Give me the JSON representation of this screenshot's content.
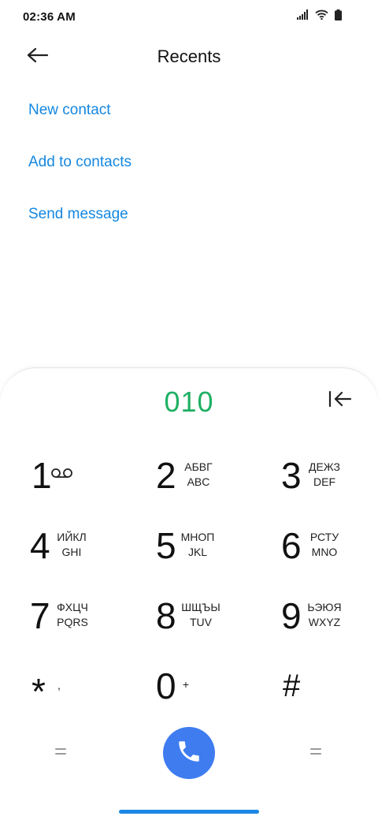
{
  "status_bar": {
    "time": "02:36 AM",
    "icons": [
      "signal-icon",
      "wifi-icon",
      "battery-icon"
    ]
  },
  "header": {
    "title": "Recents",
    "back_icon": "back-arrow-icon"
  },
  "actions": [
    {
      "label": "New contact"
    },
    {
      "label": "Add to contacts"
    },
    {
      "label": "Send message"
    }
  ],
  "dialer": {
    "number": "010",
    "backspace_icon": "backspace-icon",
    "keys": [
      {
        "digit": "1",
        "top": "",
        "bottom": "",
        "icon": "voicemail-icon"
      },
      {
        "digit": "2",
        "top": "АБВГ",
        "bottom": "ABC"
      },
      {
        "digit": "3",
        "top": "ДЕЖЗ",
        "bottom": "DEF"
      },
      {
        "digit": "4",
        "top": "ИЙКЛ",
        "bottom": "GHI"
      },
      {
        "digit": "5",
        "top": "МНОП",
        "bottom": "JKL"
      },
      {
        "digit": "6",
        "top": "РСТУ",
        "bottom": "MNO"
      },
      {
        "digit": "7",
        "top": "ФХЦЧ",
        "bottom": "PQRS"
      },
      {
        "digit": "8",
        "top": "ШЩЪЫ",
        "bottom": "TUV"
      },
      {
        "digit": "9",
        "top": "ЬЭЮЯ",
        "bottom": "WXYZ"
      },
      {
        "digit": "*",
        "top": "",
        "bottom": ","
      },
      {
        "digit": "0",
        "top": "",
        "bottom": "+"
      },
      {
        "digit": "#",
        "top": "",
        "bottom": ""
      }
    ],
    "call_icon": "phone-icon",
    "left_menu_icon": "menu-icon",
    "right_menu_icon": "menu-icon"
  },
  "colors": {
    "accent_link": "#1487e0",
    "dialed_number": "#1eb064",
    "call_button": "#3e7cf0",
    "home_indicator": "#1d87e6"
  }
}
